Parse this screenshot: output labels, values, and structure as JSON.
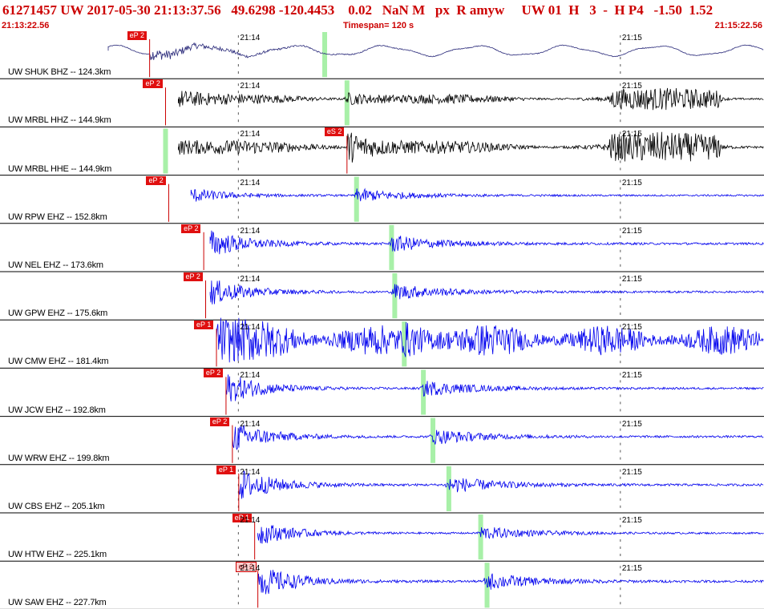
{
  "header": {
    "event_line": "61271457 UW 2017-05-30 21:13:37.56   49.6298 -120.4453    0.02   NaN M   px  R amyw     UW 01  H   3  -  H P4   -1.50  1.52",
    "time_start": "21:13:22.56",
    "timespan": "Timespan= 120 s",
    "time_end": "21:15:22.56"
  },
  "colors": {
    "header_text": "#cc0000",
    "pick_marker": "#e01010",
    "pick_line": "#cc0000",
    "s_window": "#a8f0a8",
    "trace_shuk": "#2a2a7a",
    "trace_mrbl": "#000000",
    "trace_other": "#0000ee",
    "divider": "#000000"
  },
  "chart_data": {
    "type": "seismogram",
    "x_axis": {
      "unit": "s",
      "range": [
        0,
        120
      ],
      "start_time": "21:13:22.56",
      "end_time": "21:15:22.56",
      "tick_labels": [
        "21:14",
        "21:15"
      ],
      "tick_times_s": [
        37.44,
        97.44
      ]
    },
    "traces": [
      {
        "label": "UW SHUK BHZ -- 124.3km",
        "color": "shuk",
        "start_s": 17.0,
        "p_pick_s": 23.5,
        "p_label": "eP 2",
        "s_window_s": 51.0,
        "hollow": false,
        "amplitude": 0.55,
        "style": "long"
      },
      {
        "label": "UW MRBL HHZ -- 144.9km",
        "color": "mrbl",
        "start_s": 28.0,
        "p_pick_s": 26.0,
        "p_label": "eP 2",
        "s_window_s": 54.5,
        "hollow": false,
        "amplitude": 0.55,
        "style": "dense"
      },
      {
        "label": "UW MRBL HHE -- 144.9km",
        "color": "mrbl",
        "start_s": 28.0,
        "p_pick_s": 54.5,
        "p_label": "eS 2",
        "s_window_s": 26.0,
        "hollow": false,
        "amplitude": 0.75,
        "style": "dense"
      },
      {
        "label": "UW RPW EHZ -- 152.8km",
        "color": "other",
        "start_s": 30.0,
        "p_pick_s": 26.5,
        "p_label": "eP 2",
        "s_window_s": 56.0,
        "hollow": false,
        "amplitude": 0.6,
        "style": "burst"
      },
      {
        "label": "UW NEL EHZ -- 173.6km",
        "color": "other",
        "start_s": 33.0,
        "p_pick_s": 32.0,
        "p_label": "eP 2",
        "s_window_s": 61.5,
        "hollow": false,
        "amplitude": 0.75,
        "style": "burst"
      },
      {
        "label": "UW GPW EHZ -- 175.6km",
        "color": "other",
        "start_s": 33.0,
        "p_pick_s": 32.3,
        "p_label": "eP 2",
        "s_window_s": 62.0,
        "hollow": false,
        "amplitude": 0.7,
        "style": "burst"
      },
      {
        "label": "UW CMW EHZ -- 181.4km",
        "color": "other",
        "start_s": 34.0,
        "p_pick_s": 34.0,
        "p_label": "eP 1",
        "s_window_s": 63.5,
        "hollow": false,
        "amplitude": 0.9,
        "style": "noisy"
      },
      {
        "label": "UW JCW EHZ -- 192.8km",
        "color": "other",
        "start_s": 35.5,
        "p_pick_s": 35.5,
        "p_label": "eP 2",
        "s_window_s": 66.5,
        "hollow": false,
        "amplitude": 0.7,
        "style": "burst"
      },
      {
        "label": "UW WRW EHZ -- 199.8km",
        "color": "other",
        "start_s": 36.5,
        "p_pick_s": 36.5,
        "p_label": "eP 2",
        "s_window_s": 68.0,
        "hollow": false,
        "amplitude": 0.7,
        "style": "burst"
      },
      {
        "label": "UW CBS EHZ -- 205.1km",
        "color": "other",
        "start_s": 37.5,
        "p_pick_s": 37.5,
        "p_label": "eP 1",
        "s_window_s": 70.5,
        "hollow": false,
        "amplitude": 0.75,
        "style": "burst"
      },
      {
        "label": "UW HTW EHZ -- 225.1km",
        "color": "other",
        "start_s": 40.5,
        "p_pick_s": 40.0,
        "p_label": "eP 1",
        "s_window_s": 75.5,
        "hollow": false,
        "amplitude": 0.6,
        "style": "burst"
      },
      {
        "label": "UW SAW EHZ -- 227.7km",
        "color": "other",
        "start_s": 40.5,
        "p_pick_s": 40.5,
        "p_label": "eP 2",
        "s_window_s": 76.5,
        "hollow": true,
        "amplitude": 0.75,
        "style": "burst"
      }
    ]
  }
}
